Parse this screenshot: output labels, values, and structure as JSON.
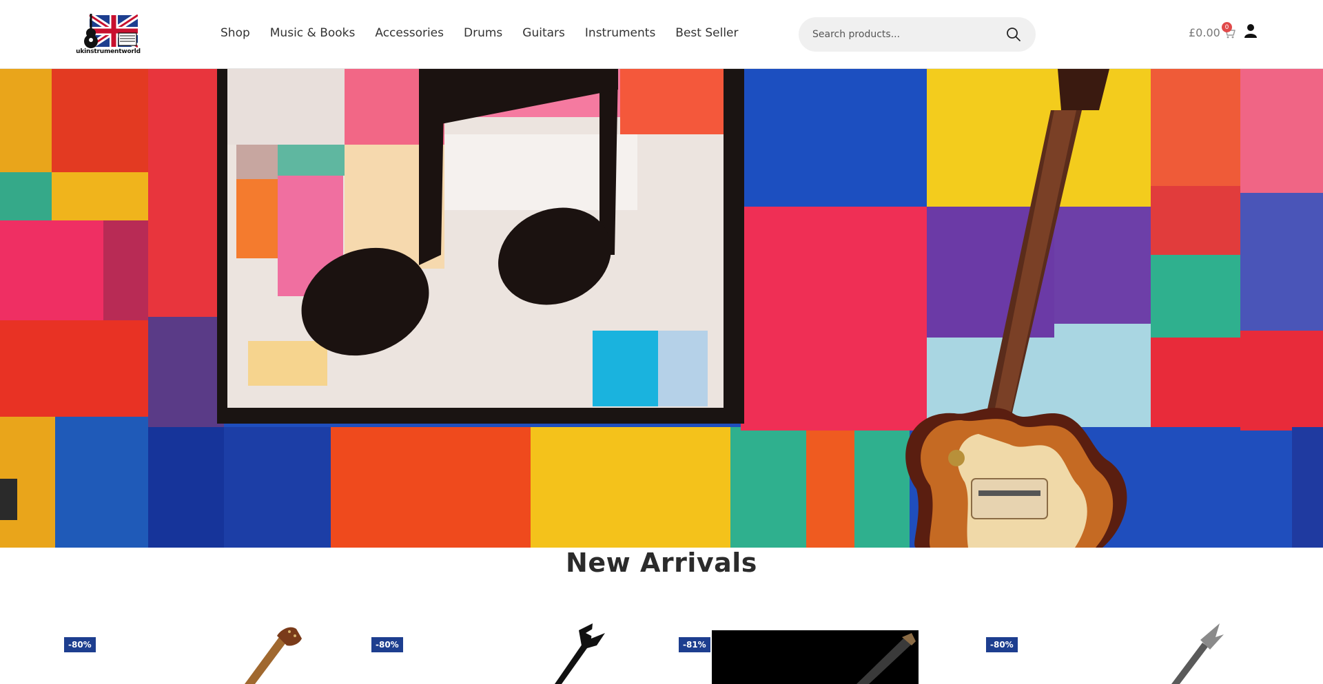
{
  "brand": {
    "logo_text": "ukinstrumentworld"
  },
  "nav": {
    "items": [
      {
        "label": "Shop"
      },
      {
        "label": "Music & Books"
      },
      {
        "label": "Accessories"
      },
      {
        "label": "Drums"
      },
      {
        "label": "Guitars"
      },
      {
        "label": "Instruments"
      },
      {
        "label": "Best Seller"
      }
    ]
  },
  "search": {
    "placeholder": "Search products..."
  },
  "cart": {
    "total": "£0.00",
    "count": "0"
  },
  "hero": {},
  "section": {
    "title": "New Arrivals"
  },
  "products": [
    {
      "discount": "-80%"
    },
    {
      "discount": "-80%"
    },
    {
      "discount": "-81%"
    },
    {
      "discount": "-80%"
    }
  ],
  "colors": {
    "badge": "#1d3e8f",
    "cart_badge": "#e04a4a",
    "search_bg": "#f0f0f0"
  }
}
